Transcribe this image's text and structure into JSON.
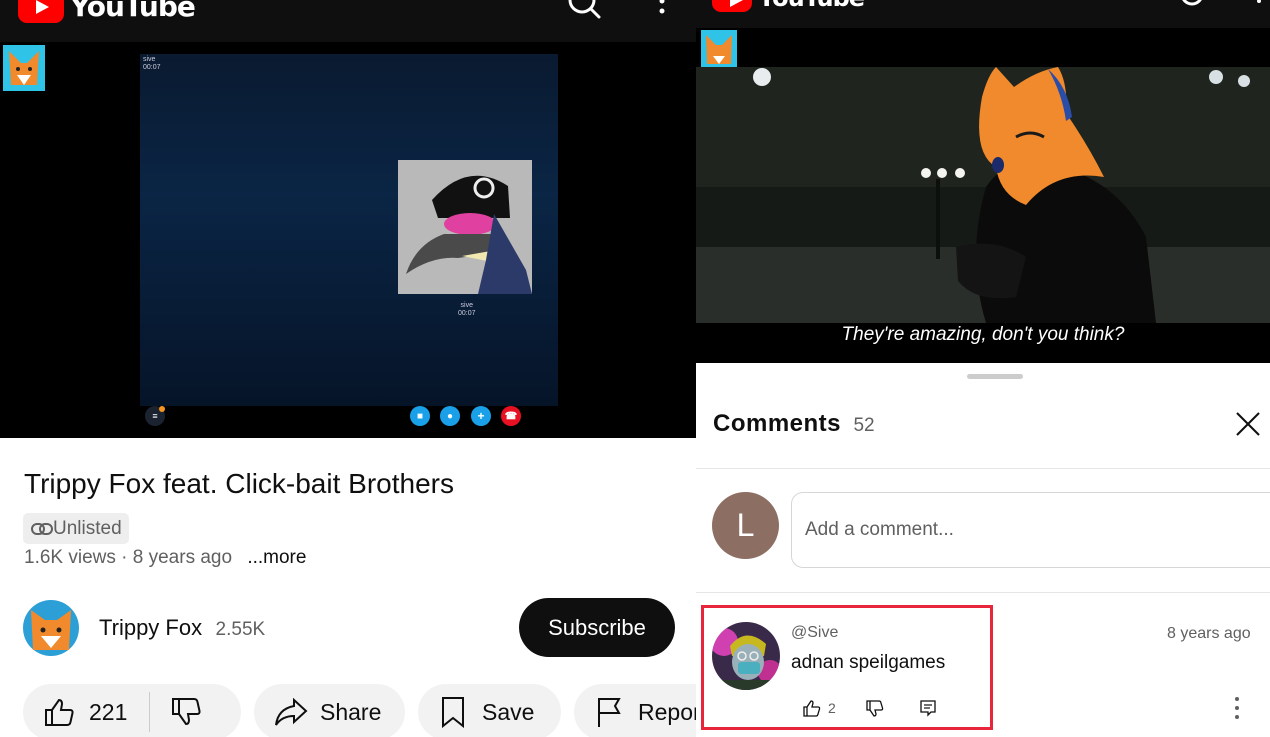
{
  "app": {
    "name": "YouTube"
  },
  "left": {
    "video": {
      "caller_name_top": "sive",
      "caller_time_top": "00:07",
      "caller_name_bottom": "sive",
      "caller_time_bottom": "00:07"
    },
    "title": "Trippy Fox feat. Click-bait Brothers",
    "badge": "Unlisted",
    "meta": "1.6K views · 8 years ago",
    "more": "...more",
    "channel": {
      "name": "Trippy Fox",
      "subscribers": "2.55K"
    },
    "subscribe_label": "Subscribe",
    "actions": {
      "likes": "221",
      "share": "Share",
      "save": "Save",
      "report": "Report"
    }
  },
  "right": {
    "subtitle": "They're amazing, don't you think?",
    "comments": {
      "title": "Comments",
      "count": "52",
      "user_initial": "L",
      "placeholder": "Add a comment...",
      "item": {
        "author": "@Sive",
        "text": "adnan speilgames",
        "time": "8 years ago",
        "likes": "2"
      }
    }
  },
  "colors": {
    "youtube_red": "#ff0000",
    "highlight_border": "#e8253a",
    "avatar_initial_bg": "#8d6e63"
  }
}
